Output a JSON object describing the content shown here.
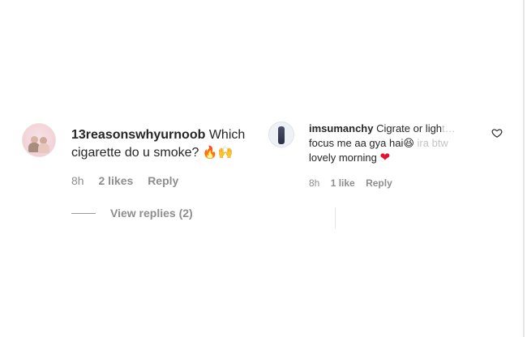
{
  "left_comment": {
    "username": "13reasonswhyurnoob",
    "text": "Which cigarette do u smoke?",
    "emojis": "🔥🙌",
    "time": "8h",
    "likes": "2 likes",
    "reply_label": "Reply",
    "view_replies": "View replies (2)"
  },
  "right_comment": {
    "username": "imsumanchy",
    "text_main": "Cigrate or ligh",
    "text_fade": "t…",
    "text_line2a": "focus me aa gya hai",
    "emoji_laugh": "😆",
    "text_fade2": " ira btw",
    "text_line3": "lovely morning",
    "heart_emoji": "❤",
    "time": "8h",
    "likes": "1 like",
    "reply_label": "Reply"
  },
  "icons": {
    "like": "heart-outline-icon"
  }
}
